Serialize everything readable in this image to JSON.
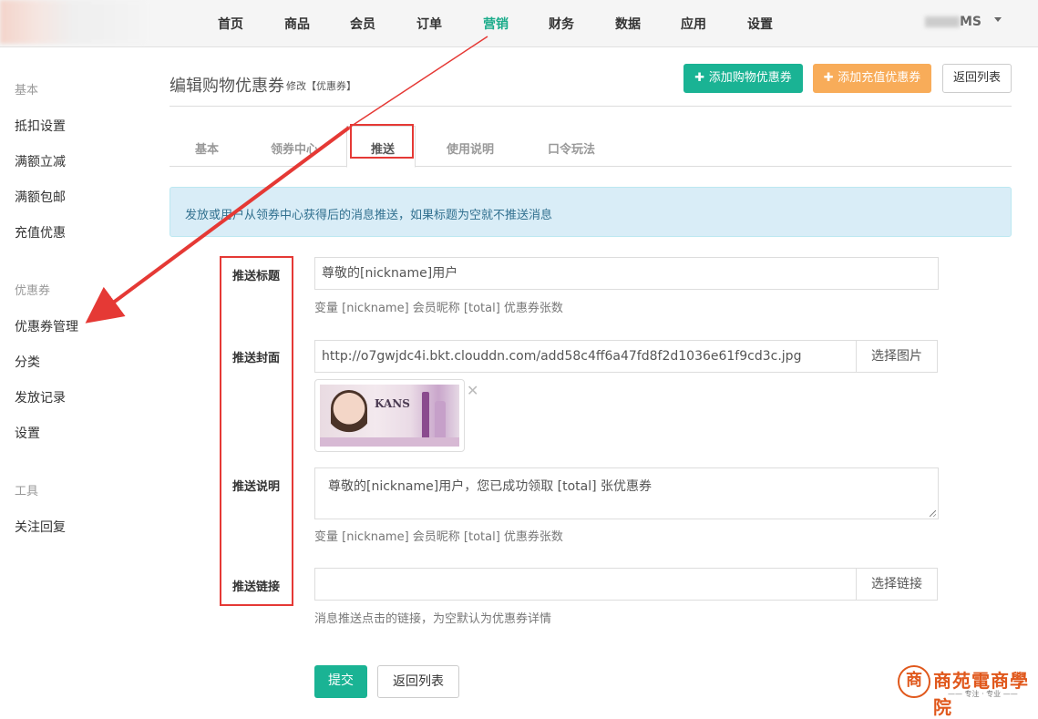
{
  "topnav": {
    "items": [
      "首页",
      "商品",
      "会员",
      "订单",
      "营销",
      "财务",
      "数据",
      "应用",
      "设置"
    ],
    "active_index": 4,
    "user_suffix": "MS"
  },
  "sidebar": {
    "groups": [
      {
        "title": "基本",
        "items": [
          "抵扣设置",
          "满额立减",
          "满额包邮",
          "充值优惠"
        ]
      },
      {
        "title": "优惠券",
        "items": [
          "优惠券管理",
          "分类",
          "发放记录",
          "设置"
        ]
      },
      {
        "title": "工具",
        "items": [
          "关注回复"
        ]
      }
    ]
  },
  "header": {
    "title": "编辑购物优惠券",
    "subtitle": "修改【优惠券】",
    "btn_add_shopping": "添加购物优惠券",
    "btn_add_recharge": "添加充值优惠券",
    "btn_back": "返回列表"
  },
  "tabs": {
    "items": [
      "基本",
      "领券中心",
      "推送",
      "使用说明",
      "口令玩法"
    ],
    "active_index": 2
  },
  "alert": {
    "text": "发放或用户从领券中心获得后的消息推送，如果标题为空就不推送消息"
  },
  "form": {
    "push_title": {
      "label": "推送标题",
      "value": "尊敬的[nickname]用户",
      "help": "变量 [nickname] 会员昵称 [total] 优惠券张数"
    },
    "push_cover": {
      "label": "推送封面",
      "value": "http://o7gwjdc4i.bkt.clouddn.com/add58c4ff6a47fd8f2d1036e61f9cd3c.jpg",
      "button": "选择图片",
      "thumb_brand": "KANS",
      "close_glyph": "✕"
    },
    "push_desc": {
      "label": "推送说明",
      "value": "尊敬的[nickname]用户，您已成功领取 [total] 张优惠券",
      "help": "变量 [nickname] 会员昵称 [total] 优惠券张数"
    },
    "push_link": {
      "label": "推送链接",
      "value": "",
      "button": "选择链接",
      "help": "消息推送点击的链接，为空默认为优惠券详情"
    }
  },
  "actions": {
    "submit": "提交",
    "back": "返回列表"
  },
  "watermark": {
    "seal": "商",
    "text": "商苑電商學院",
    "sub": "—— 专注 · 专业 ——"
  },
  "colors": {
    "accent": "#1ab394",
    "orange": "#f8ac59",
    "annotation_red": "#e53935",
    "alert_bg": "#d9edf7"
  }
}
